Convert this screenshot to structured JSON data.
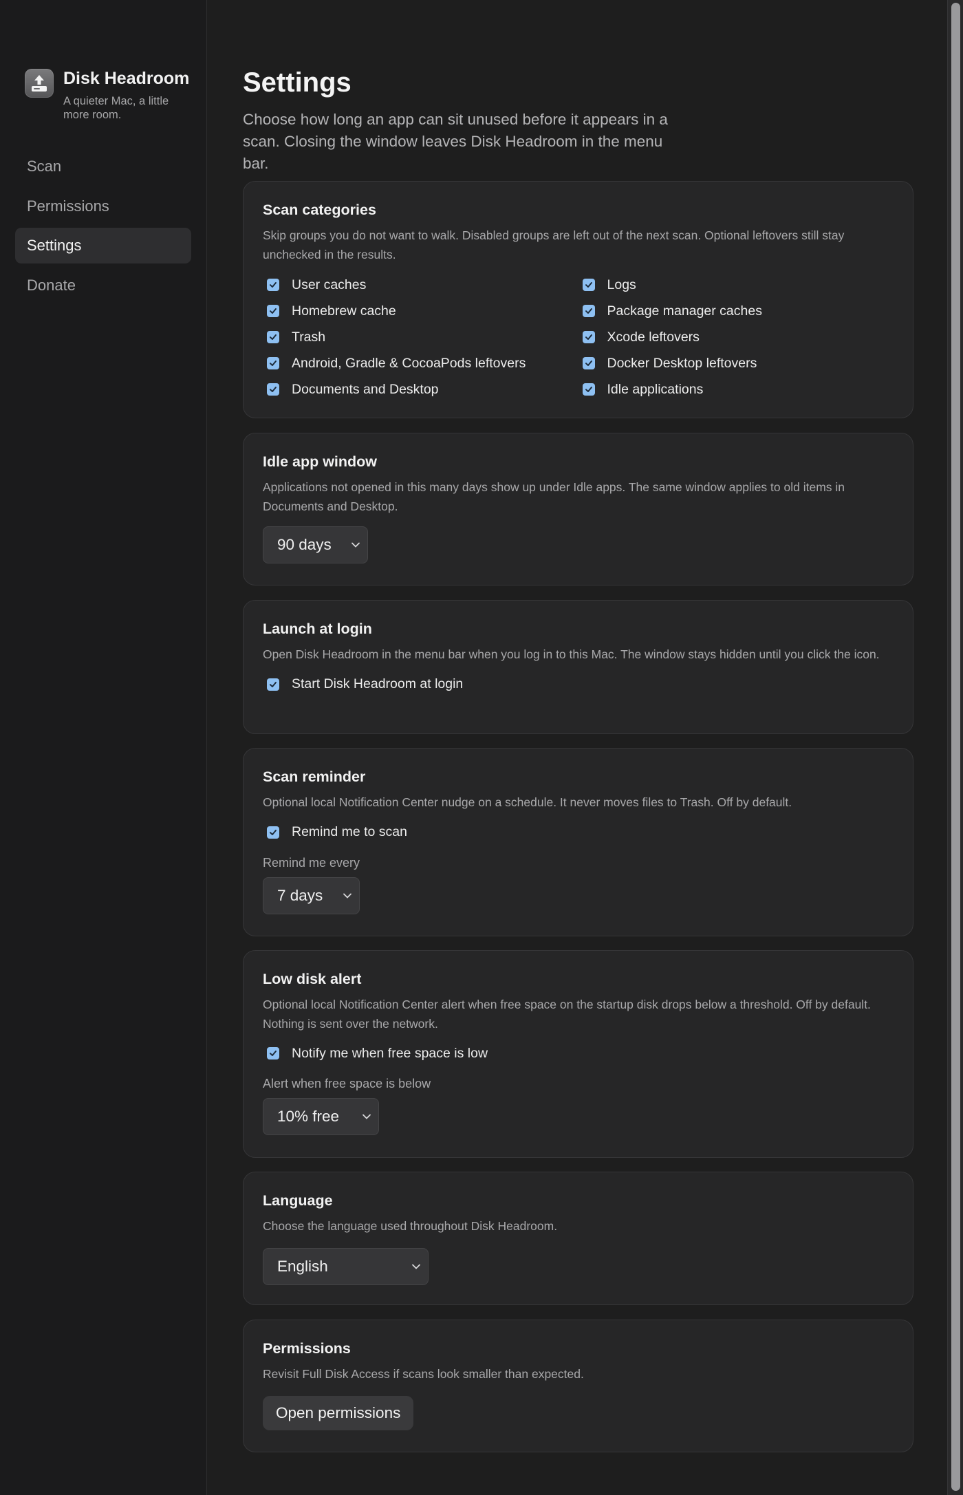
{
  "app": {
    "name": "Disk Headroom",
    "tagline": "A quieter Mac, a little more room."
  },
  "sidebar": {
    "items": [
      {
        "label": "Scan"
      },
      {
        "label": "Permissions"
      },
      {
        "label": "Settings",
        "active": true
      },
      {
        "label": "Donate"
      }
    ]
  },
  "page": {
    "title": "Settings",
    "description": "Choose how long an app can sit unused before it appears in a scan. Closing the window leaves Disk Headroom in the menu bar."
  },
  "scan_categories": {
    "title": "Scan categories",
    "description": "Skip groups you do not want to walk. Disabled groups are left out of the next scan. Optional leftovers still stay unchecked in the results.",
    "left": [
      {
        "label": "User caches",
        "checked": true
      },
      {
        "label": "Homebrew cache",
        "checked": true
      },
      {
        "label": "Trash",
        "checked": true
      },
      {
        "label": "Android, Gradle & CocoaPods leftovers",
        "checked": true
      },
      {
        "label": "Documents and Desktop",
        "checked": true
      }
    ],
    "right": [
      {
        "label": "Logs",
        "checked": true
      },
      {
        "label": "Package manager caches",
        "checked": true
      },
      {
        "label": "Xcode leftovers",
        "checked": true
      },
      {
        "label": "Docker Desktop leftovers",
        "checked": true
      },
      {
        "label": "Idle applications",
        "checked": true
      }
    ]
  },
  "idle_window": {
    "title": "Idle app window",
    "description": "Applications not opened in this many days show up under Idle apps. The same window applies to old items in Documents and Desktop.",
    "value": "90 days"
  },
  "launch_login": {
    "title": "Launch at login",
    "description": "Open Disk Headroom in the menu bar when you log in to this Mac. The window stays hidden until you click the icon.",
    "checkbox_label": "Start Disk Headroom at login",
    "checked": true
  },
  "scan_reminder": {
    "title": "Scan reminder",
    "description": "Optional local Notification Center nudge on a schedule. It never moves files to Trash. Off by default.",
    "checkbox_label": "Remind me to scan",
    "checked": true,
    "field_label": "Remind me every",
    "value": "7 days"
  },
  "low_disk": {
    "title": "Low disk alert",
    "description": "Optional local Notification Center alert when free space on the startup disk drops below a threshold. Off by default. Nothing is sent over the network.",
    "checkbox_label": "Notify me when free space is low",
    "checked": true,
    "field_label": "Alert when free space is below",
    "value": "10% free"
  },
  "language": {
    "title": "Language",
    "description": "Choose the language used throughout Disk Headroom.",
    "value": "English"
  },
  "permissions": {
    "title": "Permissions",
    "description": "Revisit Full Disk Access if scans look smaller than expected.",
    "button_label": "Open permissions"
  },
  "colors": {
    "checkbox": "#8ec0f2",
    "background": "#1e1e1e",
    "card": "#262627",
    "sidebar": "#1b1b1c"
  }
}
